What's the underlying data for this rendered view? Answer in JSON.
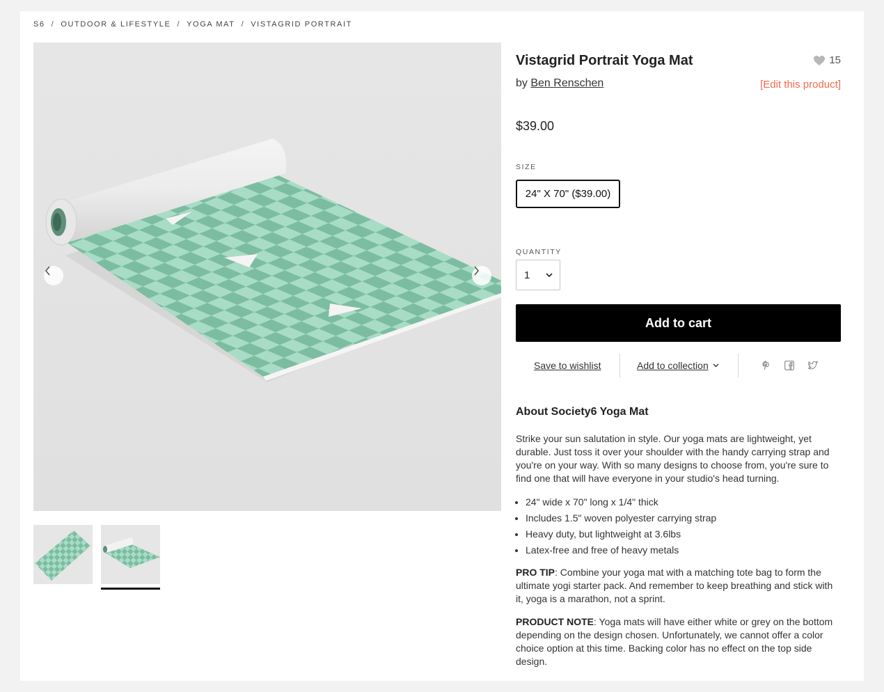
{
  "breadcrumb": {
    "items": [
      "S6",
      "OUTDOOR & LIFESTYLE",
      "YOGA MAT",
      "VISTAGRID PORTRAIT"
    ],
    "separator": "/"
  },
  "product": {
    "title": "Vistagrid Portrait Yoga Mat",
    "favorites_count": "15",
    "by_prefix": "by",
    "artist": "Ben Renschen",
    "edit_link": "[Edit this product]",
    "price": "$39.00"
  },
  "size": {
    "label": "SIZE",
    "selected": "24\" X 70\" ($39.00)"
  },
  "quantity": {
    "label": "QUANTITY",
    "value": "1"
  },
  "buttons": {
    "add_to_cart": "Add to cart",
    "save_to_wishlist": "Save to wishlist",
    "add_to_collection": "Add to collection"
  },
  "share_icons": [
    "pinterest-icon",
    "facebook-icon",
    "twitter-icon"
  ],
  "about": {
    "heading": "About Society6 Yoga Mat",
    "intro": "Strike your sun salutation in style. Our yoga mats are lightweight, yet durable. Just toss it over your shoulder with the handy carrying strap and you're on your way. With so many designs to choose from, you're sure to find one that will have everyone in your studio's head turning.",
    "bullets": [
      "24\" wide x 70\" long x 1/4\" thick",
      "Includes 1.5\" woven polyester carrying strap",
      "Heavy duty, but lightweight at 3.6lbs",
      "Latex-free and free of heavy metals"
    ],
    "pro_tip_label": "PRO TIP",
    "pro_tip": ": Combine your yoga mat with a matching tote bag to form the ultimate yogi starter pack. And remember to keep breathing and stick with it, yoga is a marathon, not a sprint.",
    "note_label": "PRODUCT NOTE",
    "note": ": Yoga mats will have either white or grey on the bottom depending on the design chosen. Unfortunately, we cannot offer a color choice option at this time. Backing color has no effect on the top side design."
  },
  "colors": {
    "accent_edit": "#f26a4b",
    "mat_light": "#a8dcc6",
    "mat_dark": "#78b89c",
    "cart_button": "#000000"
  }
}
